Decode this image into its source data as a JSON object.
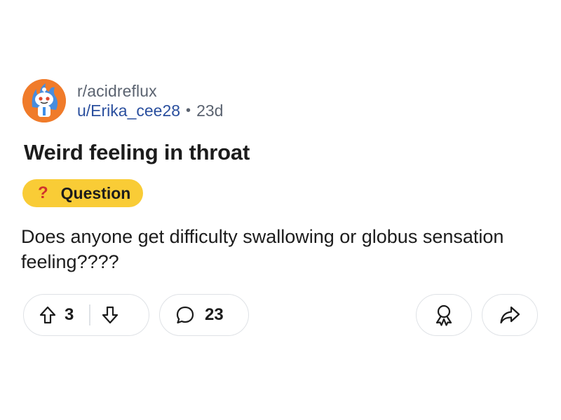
{
  "post": {
    "subreddit": "r/acidreflux",
    "username": "u/Erika_cee28",
    "separator": "•",
    "age": "23d",
    "title": "Weird feeling in throat",
    "flair": {
      "icon": "?",
      "label": "Question",
      "color": "#f9cc36"
    },
    "body": "Does anyone get difficulty swallowing or globus sensation feeling????"
  },
  "actions": {
    "upvote_icon": "arrow-up-icon",
    "vote_count": "3",
    "downvote_icon": "arrow-down-icon",
    "comment_icon": "speech-bubble-icon",
    "comment_count": "23",
    "award_icon": "award-icon",
    "share_icon": "share-arrow-icon"
  },
  "colors": {
    "subreddit_avatar": "#f07b2a",
    "username": "#2a4f9e",
    "muted_text": "#5b6370",
    "pill_border": "#dfe2e6"
  }
}
